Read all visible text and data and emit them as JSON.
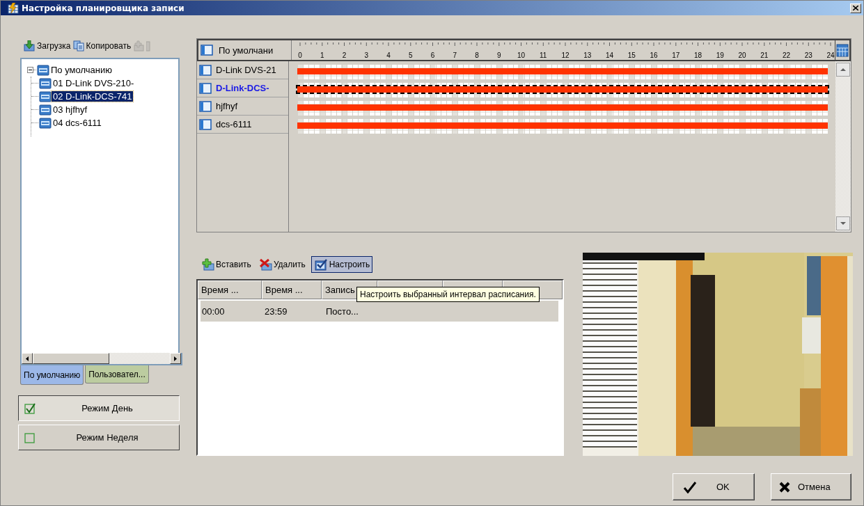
{
  "window": {
    "title": "Настройка планировщика записи"
  },
  "toolbar": [
    {
      "label": "Загрузка",
      "kind": "load",
      "disabled": false
    },
    {
      "label": "Копировать",
      "kind": "copy",
      "disabled": false
    },
    {
      "kind": "add",
      "disabled": true
    },
    {
      "kind": "stub",
      "disabled": true
    }
  ],
  "tree": {
    "label": "По умолчанию",
    "expanded": true,
    "selected": false,
    "children": [
      {
        "label": "01 D-Link DVS-210-",
        "selected": false
      },
      {
        "label": "02 D-Link-DCS-741",
        "selected": true
      },
      {
        "label": "03 hjfhyf",
        "selected": false
      },
      {
        "label": "04 dcs-6111",
        "selected": false
      }
    ]
  },
  "tree_tabs": [
    {
      "label": "По умолчанию",
      "selected": true
    },
    {
      "label": "Пользовател...",
      "selected": false
    }
  ],
  "modes": [
    {
      "label": "Режим День",
      "checked": true
    },
    {
      "label": "Режим Неделя",
      "checked": false
    }
  ],
  "schedule": {
    "header": "По умолчани",
    "hours": [
      "0",
      "1",
      "2",
      "3",
      "4",
      "5",
      "6",
      "7",
      "8",
      "9",
      "10",
      "11",
      "12",
      "13",
      "14",
      "15",
      "16",
      "17",
      "18",
      "19",
      "20",
      "21",
      "22",
      "23",
      "24"
    ],
    "rows": [
      {
        "name": "D-Link DVS-21",
        "selected": false,
        "level": 1
      },
      {
        "name": "D-Link-DCS-",
        "selected": true,
        "level": 1
      },
      {
        "name": "hjfhyf",
        "selected": false,
        "level": 1
      },
      {
        "name": "dcs-6111",
        "selected": false,
        "level": 1
      }
    ]
  },
  "intervals": {
    "toolbar": [
      {
        "label": "Вставить",
        "kind": "insert",
        "pressed": false
      },
      {
        "label": "Удалить",
        "kind": "delete",
        "pressed": false
      },
      {
        "label": "Настроить",
        "kind": "configure",
        "pressed": true
      }
    ],
    "columns": [
      "Время ...",
      "Время ...",
      "Запись"
    ],
    "rows": [
      {
        "cells": [
          "00:00",
          "23:59",
          "Посто..."
        ],
        "selected": true
      }
    ],
    "tooltip": "Настроить выбранный интервал расписания."
  },
  "buttons": [
    {
      "label": "OK",
      "kind": "ok"
    },
    {
      "label": "Отмена",
      "kind": "cancel"
    }
  ]
}
